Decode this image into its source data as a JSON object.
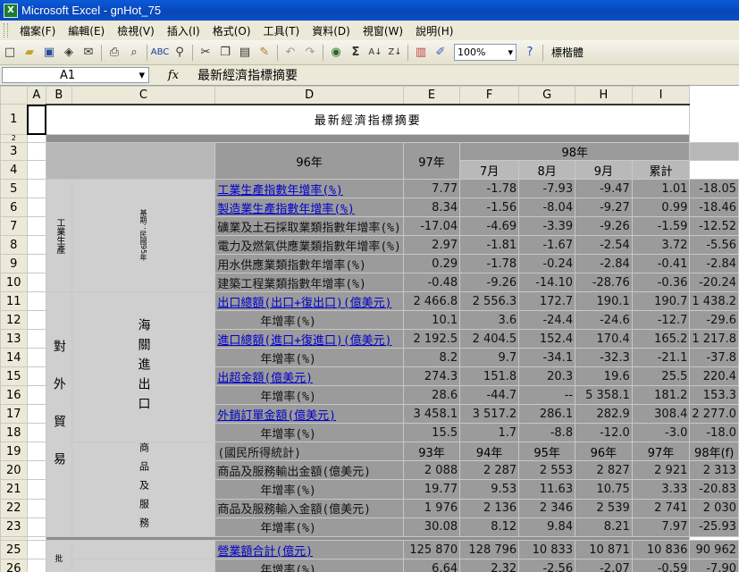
{
  "window": {
    "title": "Microsoft Excel - gnHot_75",
    "app_icon": "excel-icon"
  },
  "menu": [
    "檔案(F)",
    "編輯(E)",
    "檢視(V)",
    "插入(I)",
    "格式(O)",
    "工具(T)",
    "資料(D)",
    "視窗(W)",
    "說明(H)"
  ],
  "toolbar": {
    "zoom": "100%",
    "font": "標楷體",
    "sum": "Σ"
  },
  "formula_bar": {
    "cell_ref": "A1",
    "fx": "fx",
    "content": "最新經濟指標摘要"
  },
  "columns": [
    "A",
    "B",
    "C",
    "D",
    "E",
    "F",
    "G",
    "H",
    "I"
  ],
  "sheet": {
    "title": "最新經濟指標摘要",
    "header": {
      "y96": "96年",
      "y97": "97年",
      "y98": "98年",
      "m7": "7月",
      "m8": "8月",
      "m9": "9月",
      "cum": "累計"
    },
    "group_industry": "工業生產",
    "group_industry_note": "基期：民國95年",
    "group_trade": "對外貿易",
    "group_customs": "海關進出口",
    "group_goods": "商品及服務",
    "group_commerce": "批",
    "rows": [
      {
        "num": "5",
        "label": "工業生產指數年增率(%)",
        "link": true,
        "indent": false,
        "d": "7.77",
        "e": "-1.78",
        "f": "-7.93",
        "g": "-9.47",
        "h": "1.01",
        "i": "-18.05"
      },
      {
        "num": "6",
        "label": "製造業生產指數年增率(%)",
        "link": true,
        "indent": false,
        "d": "8.34",
        "e": "-1.56",
        "f": "-8.04",
        "g": "-9.27",
        "h": "0.99",
        "i": "-18.46"
      },
      {
        "num": "7",
        "label": "礦業及土石採取業類指數年增率(%)",
        "link": false,
        "indent": false,
        "d": "-17.04",
        "e": "-4.69",
        "f": "-3.39",
        "g": "-9.26",
        "h": "-1.59",
        "i": "-12.52"
      },
      {
        "num": "8",
        "label": "電力及燃氣供應業類指數年增率(%)",
        "link": false,
        "indent": false,
        "d": "2.97",
        "e": "-1.81",
        "f": "-1.67",
        "g": "-2.54",
        "h": "3.72",
        "i": "-5.56"
      },
      {
        "num": "9",
        "label": "用水供應業類指數年增率(%)",
        "link": false,
        "indent": false,
        "d": "0.29",
        "e": "-1.78",
        "f": "-0.24",
        "g": "-2.84",
        "h": "-0.41",
        "i": "-2.84"
      },
      {
        "num": "10",
        "label": "建築工程業類指數年增率(%)",
        "link": false,
        "indent": false,
        "d": "-0.48",
        "e": "-9.26",
        "f": "-14.10",
        "g": "-28.76",
        "h": "-0.36",
        "i": "-20.24"
      },
      {
        "num": "11",
        "label": "出口總額(出口+復出口)(億美元)",
        "link": true,
        "indent": false,
        "d": "2 466.8",
        "e": "2 556.3",
        "f": "172.7",
        "g": "190.1",
        "h": "190.7",
        "i": "1 438.2"
      },
      {
        "num": "12",
        "label": "年增率(%)",
        "link": false,
        "indent": true,
        "d": "10.1",
        "e": "3.6",
        "f": "-24.4",
        "g": "-24.6",
        "h": "-12.7",
        "i": "-29.6"
      },
      {
        "num": "13",
        "label": "進口總額(進口+復進口)(億美元)",
        "link": true,
        "indent": false,
        "d": "2 192.5",
        "e": "2 404.5",
        "f": "152.4",
        "g": "170.4",
        "h": "165.2",
        "i": "1 217.8"
      },
      {
        "num": "14",
        "label": "年增率(%)",
        "link": false,
        "indent": true,
        "d": "8.2",
        "e": "9.7",
        "f": "-34.1",
        "g": "-32.3",
        "h": "-21.1",
        "i": "-37.8"
      },
      {
        "num": "15",
        "label": "出超金額(億美元)",
        "link": true,
        "indent": false,
        "d": "274.3",
        "e": "151.8",
        "f": "20.3",
        "g": "19.6",
        "h": "25.5",
        "i": "220.4"
      },
      {
        "num": "16",
        "label": "年增率(%)",
        "link": false,
        "indent": true,
        "d": "28.6",
        "e": "-44.7",
        "f": "--",
        "g": "5 358.1",
        "h": "181.2",
        "i": "153.3"
      },
      {
        "num": "17",
        "label": "外銷訂單金額(億美元)",
        "link": true,
        "indent": false,
        "d": "3 458.1",
        "e": "3 517.2",
        "f": "286.1",
        "g": "282.9",
        "h": "308.4",
        "i": "2 277.0"
      },
      {
        "num": "18",
        "label": "年增率(%)",
        "link": false,
        "indent": true,
        "d": "15.5",
        "e": "1.7",
        "f": "-8.8",
        "g": "-12.0",
        "h": "-3.0",
        "i": "-18.0"
      },
      {
        "num": "19",
        "label": "(國民所得統計)",
        "link": false,
        "indent": false,
        "year_row": true,
        "d": "93年",
        "e": "94年",
        "f": "95年",
        "g": "96年",
        "h": "97年",
        "i": "98年(f)"
      },
      {
        "num": "20",
        "label": "商品及服務輸出金額(億美元)",
        "link": false,
        "indent": false,
        "d": "2 088",
        "e": "2 287",
        "f": "2 553",
        "g": "2 827",
        "h": "2 921",
        "i": "2 313"
      },
      {
        "num": "21",
        "label": "年增率(%)",
        "link": false,
        "indent": true,
        "d": "19.77",
        "e": "9.53",
        "f": "11.63",
        "g": "10.75",
        "h": "3.33",
        "i": "-20.83"
      },
      {
        "num": "22",
        "label": "商品及服務輸入金額(億美元)",
        "link": false,
        "indent": false,
        "d": "1 976",
        "e": "2 136",
        "f": "2 346",
        "g": "2 539",
        "h": "2 741",
        "i": "2 030"
      },
      {
        "num": "23",
        "label": "年增率(%)",
        "link": false,
        "indent": true,
        "d": "30.08",
        "e": "8.12",
        "f": "9.84",
        "g": "8.21",
        "h": "7.97",
        "i": "-25.93"
      },
      {
        "num": "25",
        "label": "營業額合計(億元)",
        "link": true,
        "indent": false,
        "d": "125 870",
        "e": "128 796",
        "f": "10 833",
        "g": "10 871",
        "h": "10 836",
        "i": "90 962"
      },
      {
        "num": "26",
        "label": "年增率(%)",
        "link": false,
        "indent": true,
        "d": "6.64",
        "e": "2.32",
        "f": "-2.56",
        "g": "-2.07",
        "h": "-0.59",
        "i": "-7.90"
      }
    ],
    "row_numbers_top": [
      "1",
      "2",
      "3",
      "4"
    ]
  }
}
